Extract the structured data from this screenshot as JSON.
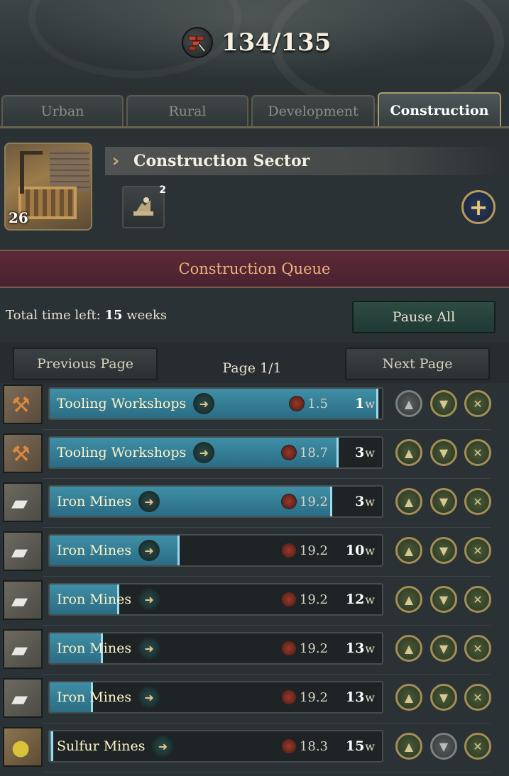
{
  "header": {
    "capacity": "134/135",
    "icon": "construction-points-icon"
  },
  "tabs": [
    {
      "label": "Urban",
      "active": false
    },
    {
      "label": "Rural",
      "active": false
    },
    {
      "label": "Development",
      "active": false
    },
    {
      "label": "Construction",
      "active": true
    }
  ],
  "sector": {
    "title": "Construction Sector",
    "level": "26",
    "method_badge": "2"
  },
  "queue": {
    "title": "Construction Queue",
    "total_time_label": "Total time left:",
    "total_time_value": "15",
    "total_time_unit": "weeks",
    "pause_label": "Pause All",
    "prev_label": "Previous Page",
    "next_label": "Next Page",
    "page_label": "Page 1/1",
    "items": [
      {
        "name": "Tooling Workshops",
        "icon": "tools-icon",
        "cost": "1.5",
        "weeks": "1",
        "unit": "w",
        "progress": 0.99,
        "up_disabled": true,
        "down_disabled": false
      },
      {
        "name": "Tooling Workshops",
        "icon": "tools-icon",
        "cost": "18.7",
        "weeks": "3",
        "unit": "w",
        "progress": 0.87,
        "up_disabled": false,
        "down_disabled": false
      },
      {
        "name": "Iron Mines",
        "icon": "iron-ingot-icon",
        "cost": "19.2",
        "weeks": "3",
        "unit": "w",
        "progress": 0.85,
        "up_disabled": false,
        "down_disabled": false
      },
      {
        "name": "Iron Mines",
        "icon": "iron-ingot-icon",
        "cost": "19.2",
        "weeks": "10",
        "unit": "w",
        "progress": 0.39,
        "up_disabled": false,
        "down_disabled": false
      },
      {
        "name": "Iron Mines",
        "icon": "iron-ingot-icon",
        "cost": "19.2",
        "weeks": "12",
        "unit": "w",
        "progress": 0.21,
        "up_disabled": false,
        "down_disabled": false
      },
      {
        "name": "Iron Mines",
        "icon": "iron-ingot-icon",
        "cost": "19.2",
        "weeks": "13",
        "unit": "w",
        "progress": 0.16,
        "up_disabled": false,
        "down_disabled": false
      },
      {
        "name": "Iron Mines",
        "icon": "iron-ingot-icon",
        "cost": "19.2",
        "weeks": "13",
        "unit": "w",
        "progress": 0.13,
        "up_disabled": false,
        "down_disabled": false
      },
      {
        "name": "Sulfur Mines",
        "icon": "sulfur-icon",
        "cost": "18.3",
        "weeks": "15",
        "unit": "w",
        "progress": 0.01,
        "up_disabled": false,
        "down_disabled": true
      }
    ]
  }
}
